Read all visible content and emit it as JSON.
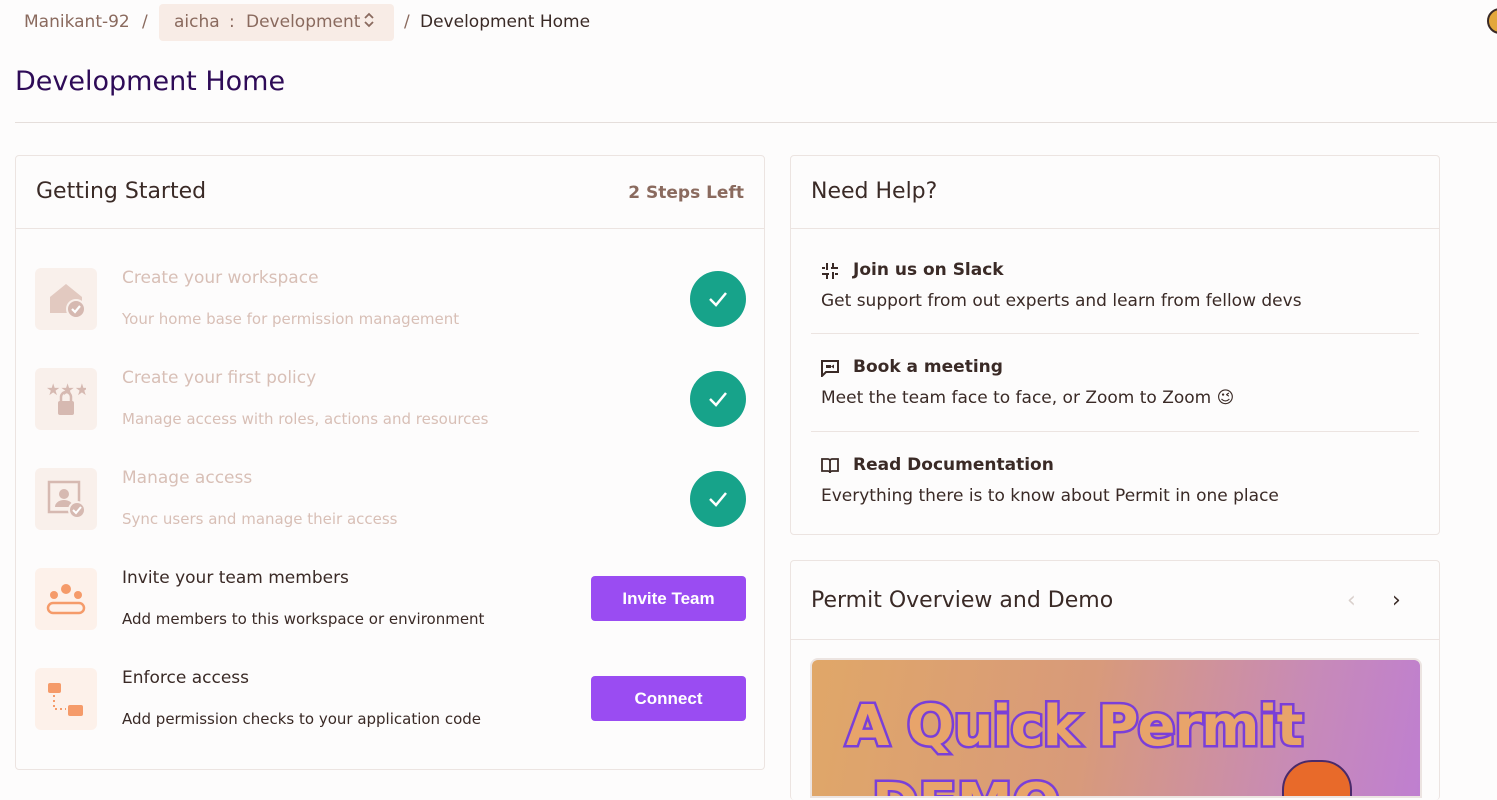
{
  "breadcrumb": {
    "org": "Manikant-92",
    "separator": "/",
    "project": "aicha",
    "env_sep": ":",
    "environment": "Development",
    "current": "Development Home"
  },
  "page": {
    "title": "Development Home"
  },
  "getting_started": {
    "title": "Getting Started",
    "steps_left": "2 Steps Left",
    "steps": [
      {
        "title": "Create your workspace",
        "desc": "Your home base for permission management",
        "status": "done",
        "icon": "house-check-icon"
      },
      {
        "title": "Create your first policy",
        "desc": "Manage access with roles, actions and resources",
        "status": "done",
        "icon": "stars-lock-icon"
      },
      {
        "title": "Manage access",
        "desc": "Sync users and manage their access",
        "status": "done",
        "icon": "user-frame-check-icon"
      },
      {
        "title": "Invite your team members",
        "desc": "Add members to this workspace or environment",
        "status": "todo",
        "button": "Invite Team",
        "icon": "team-icon"
      },
      {
        "title": "Enforce access",
        "desc": "Add permission checks to your application code",
        "status": "todo",
        "button": "Connect",
        "icon": "flow-icon"
      }
    ]
  },
  "help": {
    "title": "Need Help?",
    "items": [
      {
        "title": "Join us on Slack",
        "desc": "Get support from out experts and learn from fellow devs",
        "icon": "slack-icon"
      },
      {
        "title": "Book a meeting",
        "desc": "Meet the team face to face, or Zoom to Zoom 😉",
        "icon": "chat-video-icon"
      },
      {
        "title": "Read Documentation",
        "desc": "Everything there is to know about Permit in one place",
        "icon": "book-icon"
      }
    ]
  },
  "demo": {
    "title": "Permit Overview and Demo",
    "image_text_1": "A Quick Permit",
    "image_text_2": "DEMO",
    "prev": "‹",
    "next": "›"
  },
  "colors": {
    "accent": "#9a4cf2",
    "success": "#17a38a",
    "title": "#2e0b57"
  }
}
